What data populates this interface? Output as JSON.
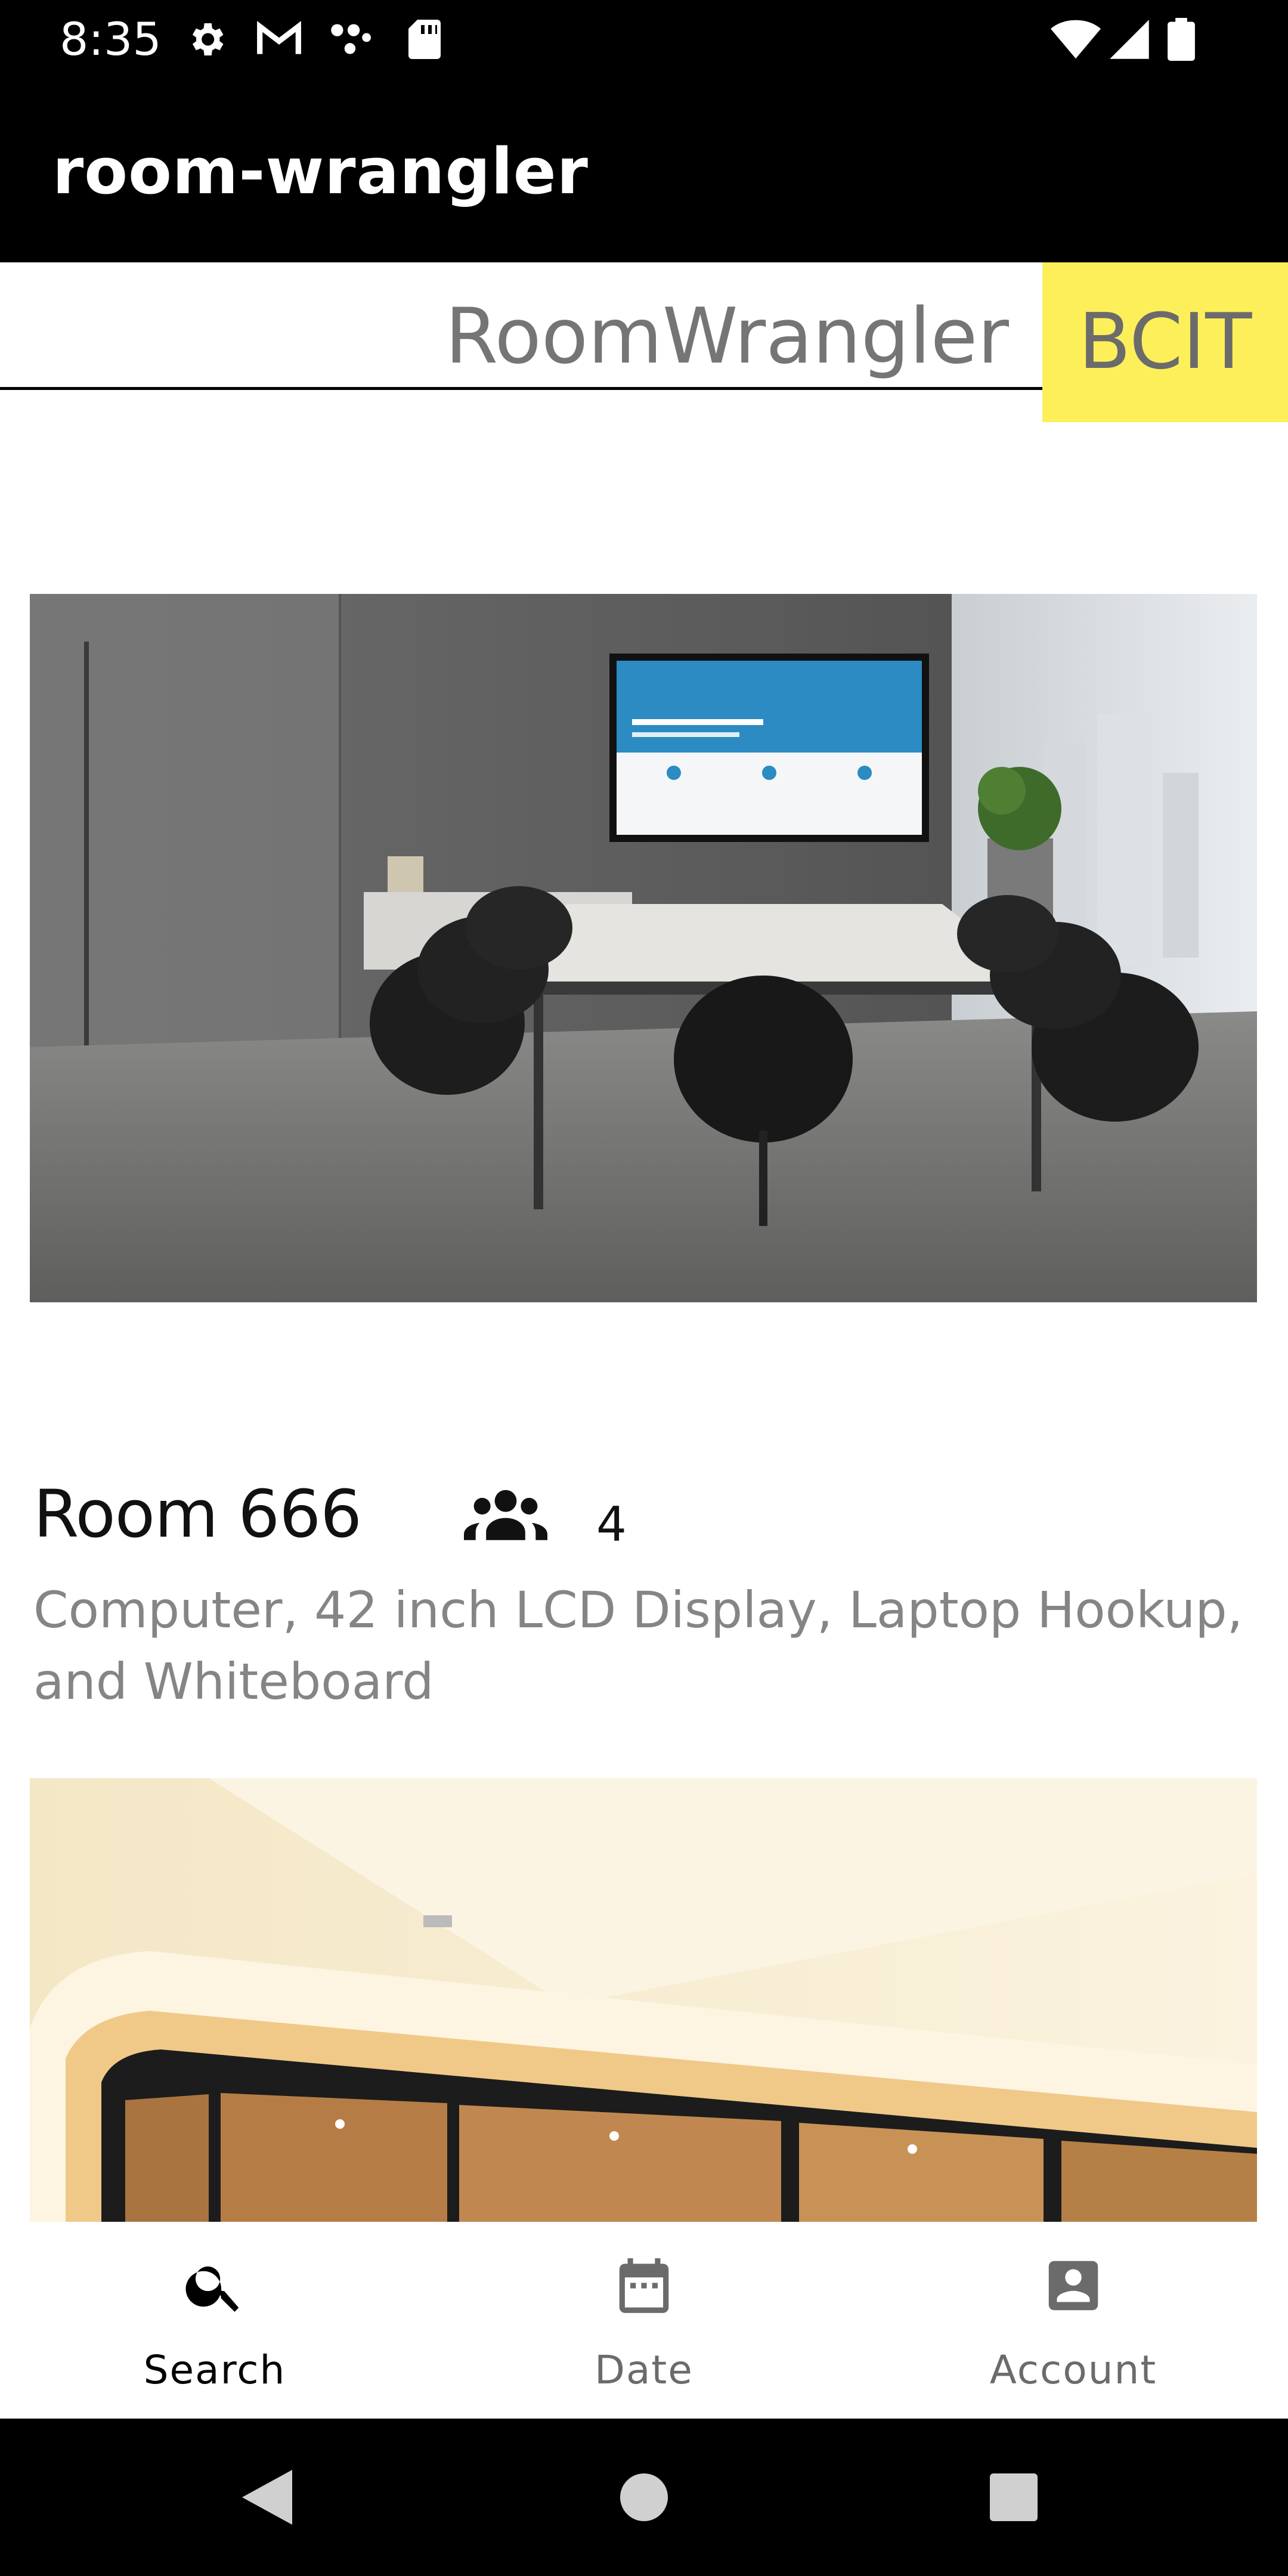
{
  "status_bar": {
    "time": "8:35",
    "left_icons": [
      "settings-icon",
      "gmail-icon",
      "dots-icon",
      "sd-card-icon"
    ],
    "right_icons": [
      "wifi-icon",
      "signal-icon",
      "battery-icon"
    ]
  },
  "app_bar": {
    "title": "room-wrangler"
  },
  "search": {
    "placeholder": "RoomWrangler",
    "badge": "BCIT",
    "badge_color": "#fcef5a"
  },
  "rooms": [
    {
      "name": "Room 666",
      "capacity": "4",
      "amenities": "Computer, 42 inch LCD Display, Laptop Hookup, and Whiteboard"
    }
  ],
  "bottom_nav": {
    "items": [
      {
        "label": "Search",
        "icon": "search-icon",
        "active": true
      },
      {
        "label": "Date",
        "icon": "calendar-icon",
        "active": false
      },
      {
        "label": "Account",
        "icon": "account-icon",
        "active": false
      }
    ]
  },
  "system_nav": {
    "buttons": [
      "back-icon",
      "home-icon",
      "recents-icon"
    ]
  }
}
